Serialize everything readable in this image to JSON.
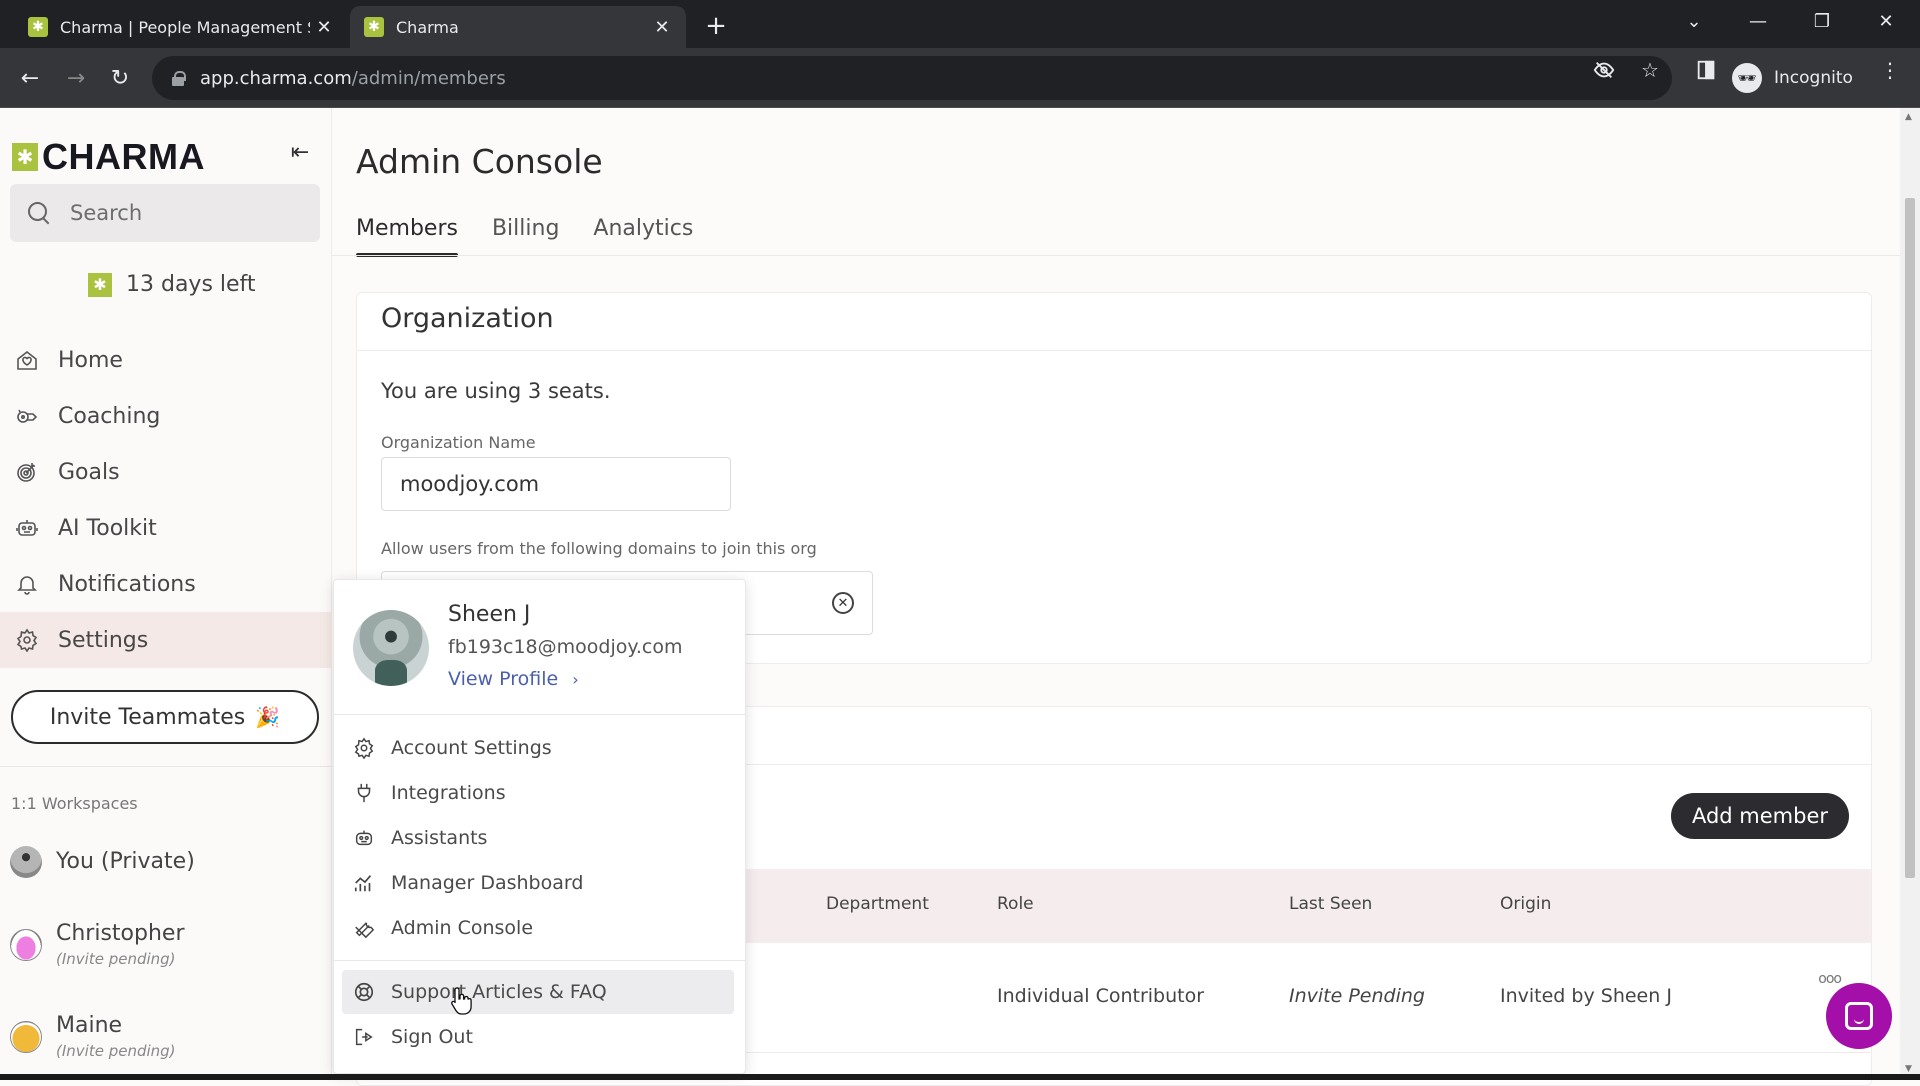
{
  "browser": {
    "tabs": [
      {
        "title": "Charma | People Management S",
        "active": false
      },
      {
        "title": "Charma",
        "active": true
      }
    ],
    "new_tab_icon": "plus-icon",
    "url_host": "app.charma.com",
    "url_path": "/admin/members",
    "profile_label": "Incognito",
    "icons": [
      "back-icon",
      "forward-icon",
      "reload-icon",
      "lock-icon",
      "eye-off-icon",
      "star-icon",
      "sidepanel-icon",
      "incognito-icon",
      "more-vert-icon"
    ]
  },
  "sidebar": {
    "logo_text": "CHARMA",
    "search_placeholder": "Search",
    "trial_text": "13 days left",
    "nav": [
      {
        "label": "Home",
        "icon": "home-icon"
      },
      {
        "label": "Coaching",
        "icon": "whistle-icon"
      },
      {
        "label": "Goals",
        "icon": "target-icon"
      },
      {
        "label": "AI Toolkit",
        "icon": "robot-icon"
      },
      {
        "label": "Notifications",
        "icon": "bell-icon"
      },
      {
        "label": "Settings",
        "icon": "gear-icon",
        "active": true
      }
    ],
    "invite_label": "Invite Teammates",
    "invite_emoji": "🎉",
    "workspaces_label": "1:1 Workspaces",
    "workspaces": [
      {
        "name": "You (Private)",
        "sub": ""
      },
      {
        "name": "Christopher",
        "sub": "(Invite pending)"
      },
      {
        "name": "Maine",
        "sub": "(Invite pending)"
      }
    ]
  },
  "main": {
    "title": "Admin Console",
    "tabs": [
      {
        "label": "Members",
        "active": true
      },
      {
        "label": "Billing",
        "active": false
      },
      {
        "label": "Analytics",
        "active": false
      }
    ],
    "organization": {
      "title": "Organization",
      "seats_text": "You are using 3 seats.",
      "name_label": "Organization Name",
      "name_value": "moodjoy.com",
      "domains_label": "Allow users from the following domains to join this org"
    },
    "members": {
      "add_member_label": "Add member",
      "columns": [
        "Department",
        "Role",
        "Last Seen",
        "Origin"
      ],
      "rows": [
        {
          "department": "",
          "role": "Individual Contributor",
          "last_seen": "Invite Pending",
          "origin": "Invited by Sheen J"
        }
      ]
    }
  },
  "user_menu": {
    "name": "Sheen J",
    "email": "fb193c18@moodjoy.com",
    "view_profile": "View Profile",
    "items": [
      {
        "label": "Account Settings",
        "icon": "gear-icon"
      },
      {
        "label": "Integrations",
        "icon": "plug-icon"
      },
      {
        "label": "Assistants",
        "icon": "robot-icon"
      },
      {
        "label": "Manager Dashboard",
        "icon": "bar-chart-icon"
      },
      {
        "label": "Admin Console",
        "icon": "wrench-icon"
      }
    ],
    "footer_items": [
      {
        "label": "Support Articles & FAQ",
        "icon": "lifebuoy-icon",
        "hovered": true
      },
      {
        "label": "Sign Out",
        "icon": "sign-out-icon"
      }
    ]
  },
  "colors": {
    "brand_green": "#a9c23f",
    "chat_purple": "#a30fa8",
    "link_blue": "#4a5fae",
    "active_nav_bg": "#f4e9e6"
  }
}
